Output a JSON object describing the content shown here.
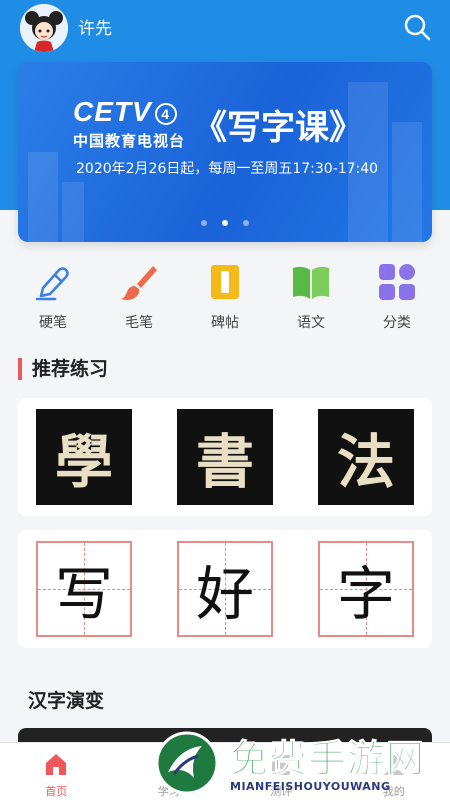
{
  "header": {
    "username": "许先",
    "avatar_icon": "girl-avatar-icon",
    "search_icon": "search-icon"
  },
  "banner": {
    "logo_text": "CETV",
    "logo_channel": "4",
    "logo_subtitle": "中国教育电视台",
    "title": "《写字课》",
    "date_text": "2020年2月26日起，每周一至周五17:30-17:40",
    "dot_count": 3,
    "active_dot": 2
  },
  "categories": [
    {
      "label": "硬笔",
      "icon": "pen-icon",
      "color": "#3a7ee8"
    },
    {
      "label": "毛笔",
      "icon": "brush-icon",
      "color": "#ef6a4a"
    },
    {
      "label": "碑帖",
      "icon": "tablet-icon",
      "color": "#f5b91a"
    },
    {
      "label": "语文",
      "icon": "book-icon",
      "color": "#58b947"
    },
    {
      "label": "分类",
      "icon": "grid-icon",
      "color": "#8a73e8"
    }
  ],
  "recommend": {
    "title": "推荐练习",
    "calligraphy": [
      "學",
      "書",
      "法"
    ],
    "handwriting": [
      "写",
      "好",
      "字"
    ]
  },
  "evolution": {
    "title": "汉字演变"
  },
  "tabbar": [
    {
      "label": "首页",
      "icon": "home-icon",
      "active": true
    },
    {
      "label": "学习",
      "icon": "study-icon",
      "active": false
    },
    {
      "label": "测评",
      "icon": "review-icon",
      "active": false
    },
    {
      "label": "我的",
      "icon": "profile-icon",
      "active": false
    }
  ],
  "watermark": {
    "title": "免费手游网",
    "subtitle": "MIANFEISHOUYOUWANG"
  },
  "colors": {
    "header_blue": "#1f8de6",
    "accent_red": "#f0565a",
    "grid_pink": "#e88a86"
  }
}
